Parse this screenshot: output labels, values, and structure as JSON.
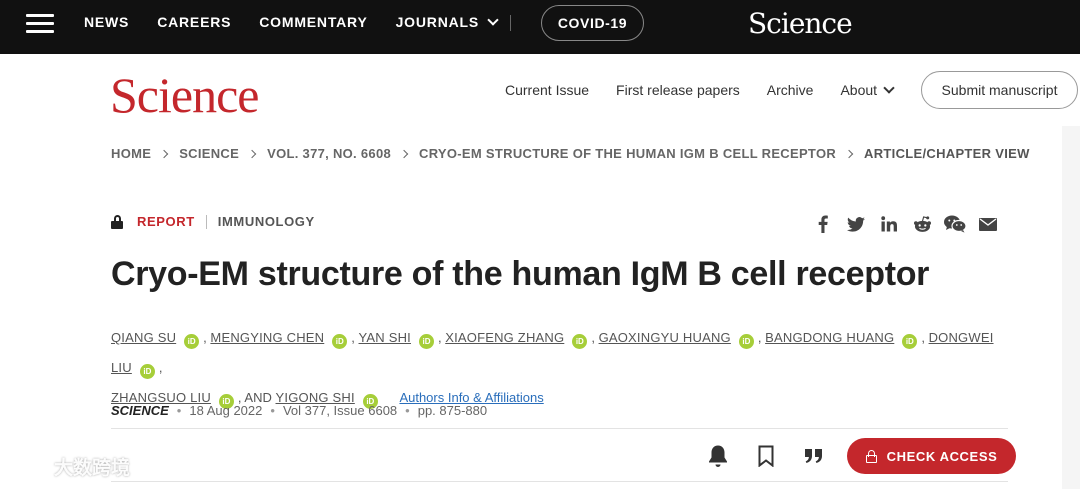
{
  "topbar": {
    "nav": [
      {
        "label": "NEWS"
      },
      {
        "label": "CAREERS"
      },
      {
        "label": "COMMENTARY"
      },
      {
        "label": "JOURNALS"
      }
    ],
    "covid_label": "COVID-19",
    "logo_text": "Science"
  },
  "header": {
    "logo_text": "Science",
    "nav": [
      {
        "label": "Current Issue"
      },
      {
        "label": "First release papers"
      },
      {
        "label": "Archive"
      },
      {
        "label": "About"
      }
    ],
    "submit_label": "Submit manuscript"
  },
  "breadcrumb": [
    "HOME",
    "SCIENCE",
    "VOL. 377, NO. 6608",
    "CRYO-EM STRUCTURE OF THE HUMAN IGM B CELL RECEPTOR",
    "ARTICLE/CHAPTER VIEW"
  ],
  "article": {
    "type": "REPORT",
    "subject": "IMMUNOLOGY",
    "title": "Cryo-EM structure of the human IgM B cell receptor",
    "authors": [
      "QIANG SU",
      "MENGYING CHEN",
      "YAN SHI",
      "XIAOFENG ZHANG",
      "GAOXINGYU HUANG",
      "BANGDONG HUANG",
      "DONGWEI LIU",
      "ZHANGSUO LIU",
      "YIGONG SHI"
    ],
    "author_separator": ",",
    "and_text": ", AND",
    "orcid_label": "iD",
    "affiliations_link": "Authors Info & Affiliations",
    "journal": "SCIENCE",
    "date": "18 Aug 2022",
    "volume_issue": "Vol 377, Issue 6608",
    "pages": "pp. 875-880",
    "dot": "•"
  },
  "share_icons": [
    "facebook-icon",
    "twitter-icon",
    "linkedin-icon",
    "reddit-icon",
    "wechat-icon",
    "email-icon"
  ],
  "actions": {
    "icons": [
      "bell-icon",
      "bookmark-icon",
      "quote-icon"
    ],
    "check_access_label": "CHECK ACCESS"
  },
  "watermark": {
    "text": "大数跨境"
  },
  "colors": {
    "brand_red": "#c4272c",
    "orcid_green": "#a6ce39",
    "link_blue": "#2a6ebb",
    "topbar_bg": "#111111"
  }
}
